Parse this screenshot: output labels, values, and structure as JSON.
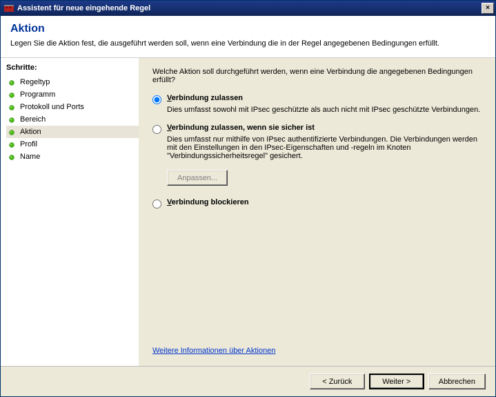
{
  "window": {
    "title": "Assistent für neue eingehende Regel",
    "close_label": "×"
  },
  "header": {
    "heading": "Aktion",
    "description": "Legen Sie die Aktion fest, die ausgeführt werden soll, wenn eine Verbindung die in der Regel angegebenen Bedingungen erfüllt."
  },
  "sidebar": {
    "title": "Schritte:",
    "steps": [
      {
        "label": "Regeltyp"
      },
      {
        "label": "Programm"
      },
      {
        "label": "Protokoll und Ports"
      },
      {
        "label": "Bereich"
      },
      {
        "label": "Aktion"
      },
      {
        "label": "Profil"
      },
      {
        "label": "Name"
      }
    ],
    "active_index": 4
  },
  "main": {
    "question": "Welche Aktion soll durchgeführt werden, wenn eine Verbindung die angegebenen Bedingungen erfüllt?",
    "options": [
      {
        "id": "allow",
        "label_html": "Verbindung zulassen",
        "underline_first": "V",
        "rest": "erbindung zulassen",
        "desc": "Dies umfasst sowohl mit IPsec geschützte als auch nicht mit IPsec geschützte Verbindungen.",
        "selected": true
      },
      {
        "id": "allow_secure",
        "underline_first": "V",
        "rest": "erbindung zulassen, wenn sie sicher ist",
        "desc": "Dies umfasst nur mithilfe von IPsec authentifizierte Verbindungen. Die Verbindungen werden mit den Einstellungen in den IPsec-Eigenschaften und -regeln im Knoten \"Verbindungssicherheitsregel\" gesichert.",
        "selected": false
      },
      {
        "id": "block",
        "underline_first": "V",
        "rest": "erbindung blockieren",
        "desc": "",
        "selected": false
      }
    ],
    "customize_label": "Anpassen...",
    "help_link": "Weitere Informationen über Aktionen"
  },
  "buttons": {
    "back": "< Zurück",
    "next": "Weiter >",
    "cancel": "Abbrechen"
  },
  "icons": {
    "bullet": "step-bullet",
    "app": "firewall-icon"
  }
}
